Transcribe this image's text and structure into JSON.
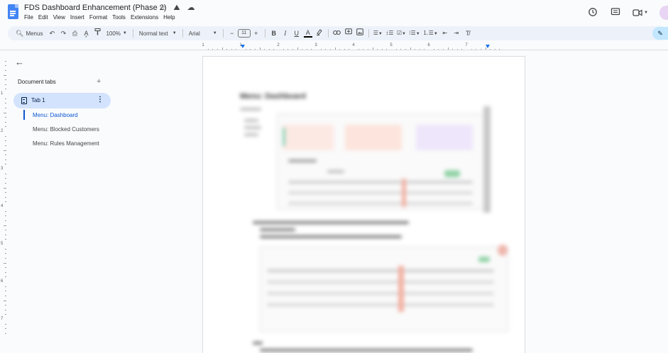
{
  "document": {
    "title": "FDS Dashboard Enhancement (Phase 2)",
    "menus": [
      "File",
      "Edit",
      "View",
      "Insert",
      "Format",
      "Tools",
      "Extensions",
      "Help"
    ]
  },
  "toolbar": {
    "search_label": "Menus",
    "zoom": "100%",
    "style": "Normal text",
    "font": "Arial",
    "font_size": "11",
    "decrease": "−",
    "increase": "+"
  },
  "ruler": {
    "h_numbers": [
      "1",
      "1",
      "2",
      "3",
      "4",
      "5",
      "6",
      "7"
    ],
    "v_numbers": [
      "1",
      "2",
      "3",
      "4",
      "5",
      "6",
      "7"
    ]
  },
  "sidebar": {
    "header": "Document tabs",
    "tab_label": "Tab 1",
    "outline": [
      {
        "label": "Menu: Dashboard",
        "active": true
      },
      {
        "label": "Menu: Blocked Customers",
        "active": false
      },
      {
        "label": "Menu: Rules Management",
        "active": false
      }
    ]
  },
  "page": {
    "heading": "Menu: Dashboard"
  },
  "colors": {
    "accent": "#0b57d0",
    "tab_bg": "#d3e3fd",
    "toolbar_bg": "#edf2fa",
    "doc_icon": "#4285f4"
  },
  "icons": {
    "undo": "↶",
    "redo": "↷",
    "print": "⎙",
    "spellcheck": "A͓",
    "paint_format": "¶",
    "link": "⛓",
    "comment": "+",
    "image": "▣",
    "back": "←",
    "more": "⋮"
  }
}
